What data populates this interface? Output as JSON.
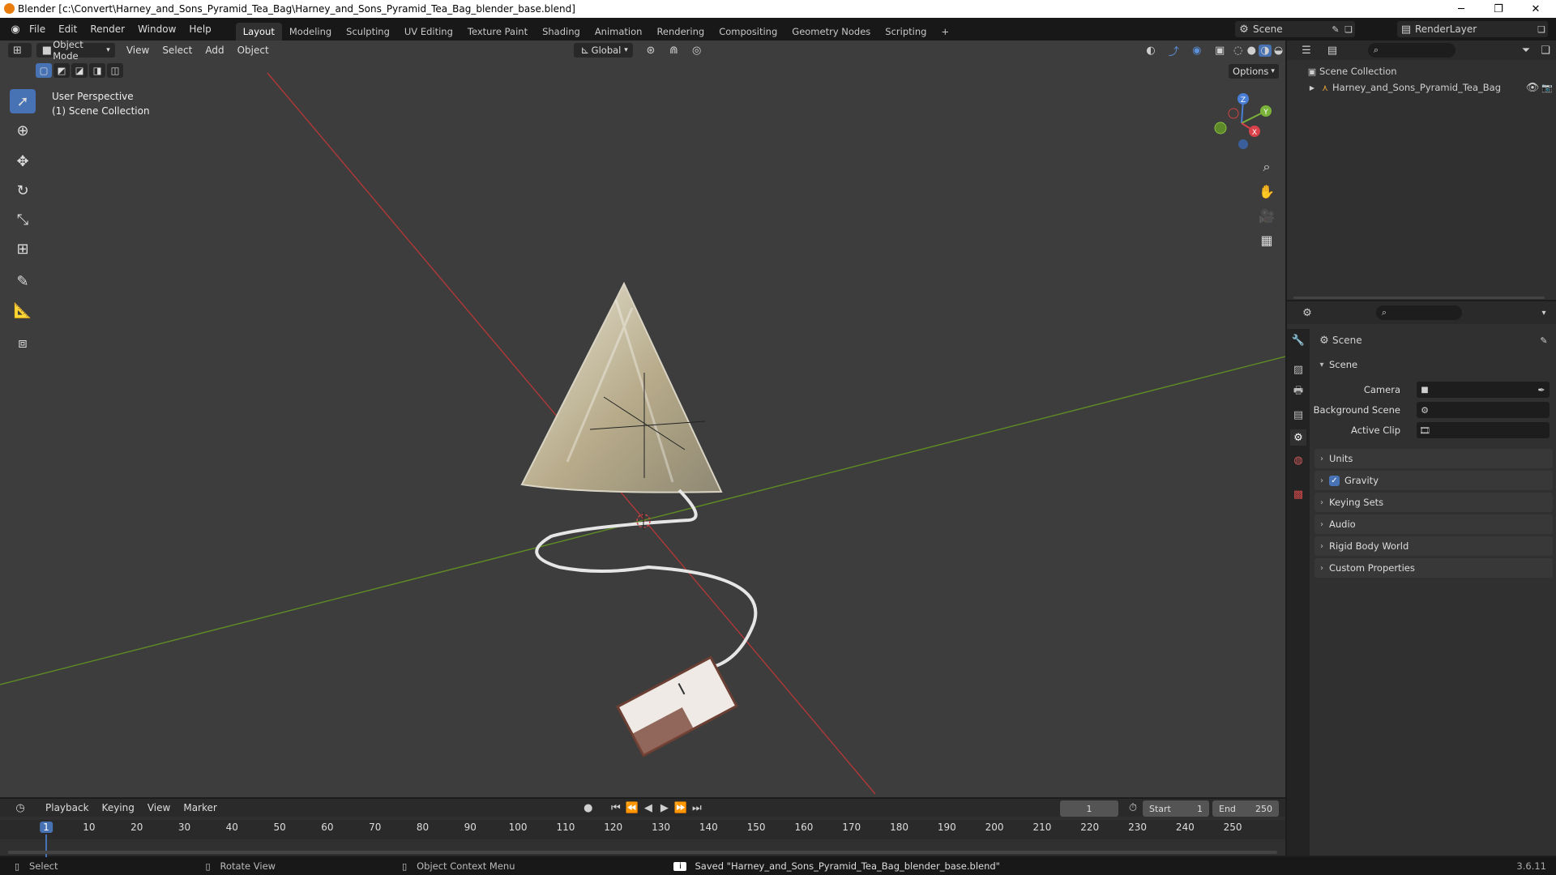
{
  "window": {
    "title": "Blender [c:\\Convert\\Harney_and_Sons_Pyramid_Tea_Bag\\Harney_and_Sons_Pyramid_Tea_Bag_blender_base.blend]",
    "minimize": "─",
    "restore": "❐",
    "close": "✕"
  },
  "menu": {
    "items": [
      "File",
      "Edit",
      "Render",
      "Window",
      "Help"
    ]
  },
  "workspaces": [
    "Layout",
    "Modeling",
    "Sculpting",
    "UV Editing",
    "Texture Paint",
    "Shading",
    "Animation",
    "Rendering",
    "Compositing",
    "Geometry Nodes",
    "Scripting"
  ],
  "workspace_add": "+",
  "scene_selector": {
    "value": "Scene"
  },
  "render_layer": {
    "value": "RenderLayer"
  },
  "viewport": {
    "mode": "Object Mode",
    "menus": [
      "View",
      "Select",
      "Add",
      "Object"
    ],
    "transform_orientation": "Global",
    "options": "Options",
    "overlay_title": "User Perspective",
    "overlay_subtitle": "(1) Scene Collection",
    "gizmo_axes": {
      "x": "X",
      "y": "Y",
      "z": "Z"
    }
  },
  "outliner": {
    "root": "Scene Collection",
    "items": [
      {
        "label": "Harney_and_Sons_Pyramid_Tea_Bag"
      }
    ]
  },
  "properties": {
    "context": "Scene",
    "section": "Scene",
    "fields": {
      "camera": "Camera",
      "background_scene": "Background Scene",
      "active_clip": "Active Clip"
    },
    "panels": [
      "Units",
      "Gravity",
      "Keying Sets",
      "Audio",
      "Rigid Body World",
      "Custom Properties"
    ],
    "gravity_checked": true
  },
  "timeline": {
    "menus": [
      "Playback",
      "Keying",
      "View",
      "Marker"
    ],
    "current_frame": "1",
    "start_label": "Start",
    "start": "1",
    "end_label": "End",
    "end": "250",
    "ruler": [
      "1",
      "10",
      "20",
      "30",
      "40",
      "50",
      "60",
      "70",
      "80",
      "90",
      "100",
      "110",
      "120",
      "130",
      "140",
      "150",
      "160",
      "170",
      "180",
      "190",
      "200",
      "210",
      "220",
      "230",
      "240",
      "250"
    ]
  },
  "statusbar": {
    "select": "Select",
    "rotate": "Rotate View",
    "context_menu": "Object Context Menu",
    "message": "Saved \"Harney_and_Sons_Pyramid_Tea_Bag_blender_base.blend\"",
    "version": "3.6.11"
  },
  "colors": {
    "accent": "#4772b3",
    "x_axis": "#c33c3c",
    "y_axis": "#6b9c2a",
    "brand": "#e87d0d"
  }
}
